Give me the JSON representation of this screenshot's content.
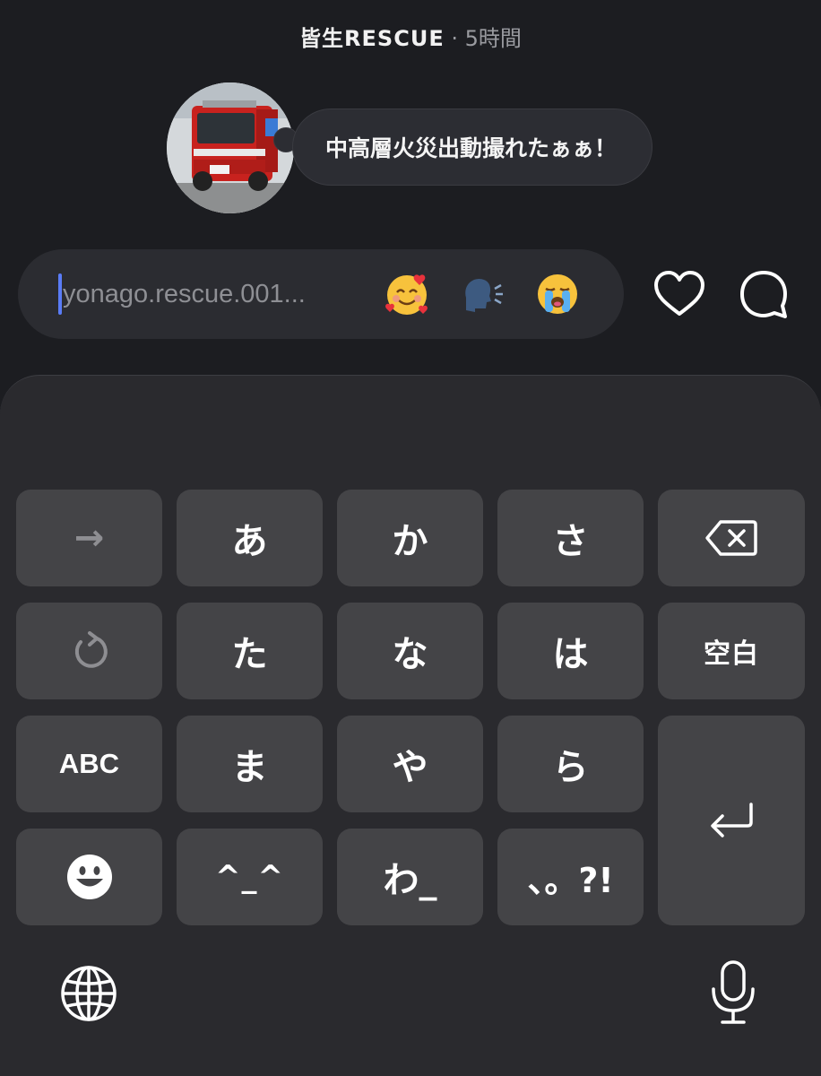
{
  "header": {
    "username": "皆生RESCUE",
    "separator": "·",
    "time_ago": "5時間"
  },
  "story": {
    "avatar_icon": "fire-truck-photo",
    "note_text": "中高層火災出動撮れたぁぁ！"
  },
  "reply": {
    "placeholder": "yonago.rescue.001...",
    "quick_reactions": [
      "smiling-face-with-hearts",
      "speaking-head",
      "loudly-crying-face"
    ],
    "like_icon": "heart-icon",
    "comment_icon": "comment-icon"
  },
  "keyboard": {
    "rows": [
      [
        "→",
        "あ",
        "か",
        "さ",
        "⌫"
      ],
      [
        "↺",
        "た",
        "な",
        "は",
        "空白"
      ],
      [
        "ABC",
        "ま",
        "や",
        "ら",
        "↵"
      ],
      [
        "☻",
        "^_^",
        "わ_",
        "、。?!"
      ]
    ],
    "next_key": "→",
    "undo_key": "↺",
    "abc_key": "ABC",
    "emoji_key": "smiling-face-icon",
    "delete_key": "delete-icon",
    "space_key": "空白",
    "return_key": "return-icon",
    "kana": {
      "a": "あ",
      "ka": "か",
      "sa": "さ",
      "ta": "た",
      "na": "な",
      "ha": "は",
      "ma": "ま",
      "ya": "や",
      "ra": "ら",
      "face": "^_^",
      "wa": "わ_",
      "punct": "、。?!"
    },
    "globe_icon": "globe-icon",
    "mic_icon": "microphone-icon"
  }
}
